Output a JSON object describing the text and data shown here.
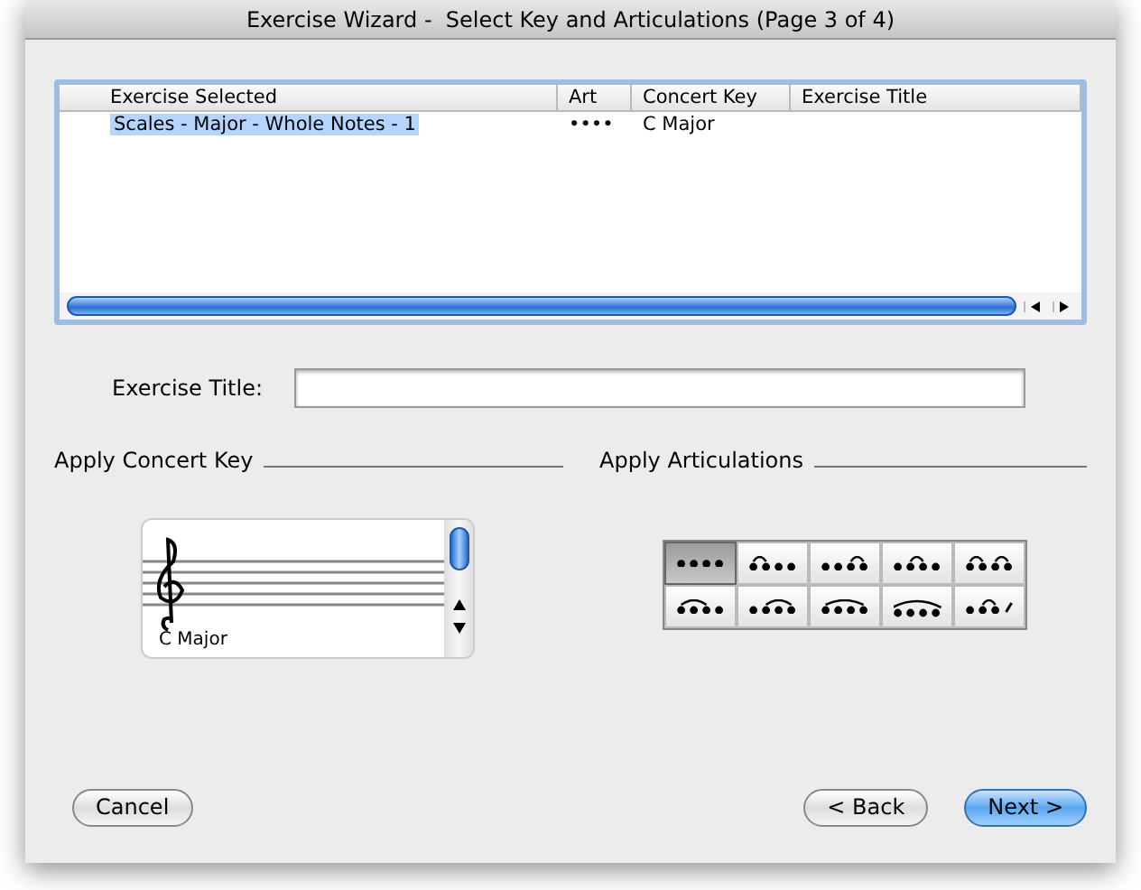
{
  "window": {
    "title": "Exercise Wizard -  Select Key and Articulations (Page 3 of 4)"
  },
  "table": {
    "columns": [
      "Exercise Selected",
      "Art",
      "Concert Key",
      "Exercise Title"
    ],
    "rows": [
      {
        "cells": [
          "Scales  - Major  - Whole Notes - 1",
          "••••",
          "C Major",
          ""
        ],
        "selected": true
      }
    ]
  },
  "title_field": {
    "label": "Exercise Title:"
  },
  "concert_key": {
    "heading": "Apply Concert Key",
    "key_name": "C Major"
  },
  "articulations": {
    "heading": "Apply Articulations",
    "items": [
      {
        "kind": "plain",
        "selected": true
      },
      {
        "kind": "slur-12",
        "selected": false
      },
      {
        "kind": "slur-34",
        "selected": false
      },
      {
        "kind": "slur-23",
        "selected": false
      },
      {
        "kind": "slur-12-34",
        "selected": false
      },
      {
        "kind": "slur-123",
        "selected": false
      },
      {
        "kind": "slur-234",
        "selected": false
      },
      {
        "kind": "slur-1234",
        "selected": false
      },
      {
        "kind": "slur-1234-long",
        "selected": false
      },
      {
        "kind": "slur-23-tick",
        "selected": false
      }
    ]
  },
  "buttons": [
    {
      "label": "Cancel",
      "default": false
    },
    {
      "label": "< Back",
      "default": false
    },
    {
      "label": "Next >",
      "default": true
    }
  ]
}
